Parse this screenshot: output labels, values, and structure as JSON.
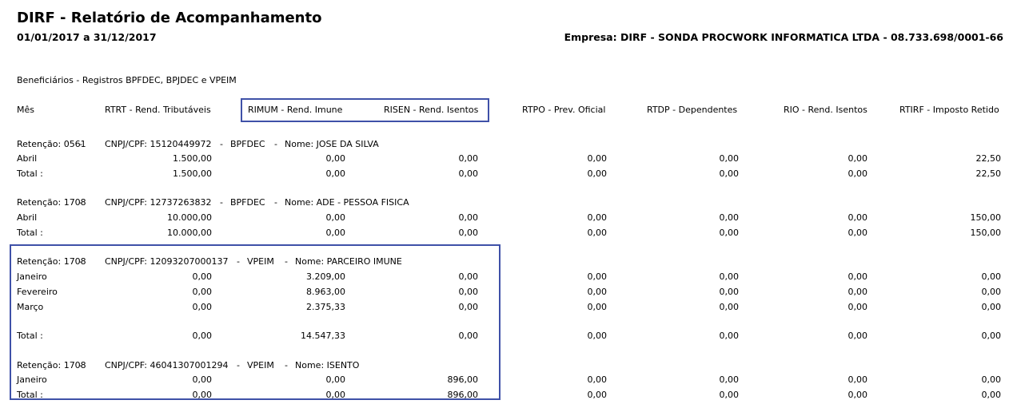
{
  "report": {
    "title": "DIRF - Relatório de Acompanhamento",
    "period": "01/01/2017 a 31/12/2017",
    "company": "Empresa: DIRF - SONDA PROCWORK INFORMATICA LTDA - 08.733.698/0001-66",
    "section": "Beneficiários - Registros BPFDEC, BPJDEC e VPEIM"
  },
  "columns": [
    "Mês",
    "RTRT - Rend. Tributáveis",
    "RIMUM - Rend. Imune",
    "RISEN - Rend. Isentos",
    "RTPO - Prev. Oficial",
    "RTDP - Dependentes",
    "RIO - Rend. Isentos",
    "RTIRF - Imposto Retido"
  ],
  "groups": [
    {
      "retencao": "Retenção: 0561",
      "cnpj": "CNPJ/CPF: 15120449972",
      "tipo": "BPFDEC",
      "nome": "Nome: JOSE DA SILVA",
      "rows": [
        {
          "label": "Abril",
          "values": [
            "1.500,00",
            "0,00",
            "0,00",
            "0,00",
            "0,00",
            "0,00",
            "22,50"
          ]
        },
        {
          "label": "Total :",
          "values": [
            "1.500,00",
            "0,00",
            "0,00",
            "0,00",
            "0,00",
            "0,00",
            "22,50"
          ]
        }
      ]
    },
    {
      "retencao": "Retenção: 1708",
      "cnpj": "CNPJ/CPF: 12737263832",
      "tipo": "BPFDEC",
      "nome": "Nome: ADE - PESSOA FISICA",
      "rows": [
        {
          "label": "Abril",
          "values": [
            "10.000,00",
            "0,00",
            "0,00",
            "0,00",
            "0,00",
            "0,00",
            "150,00"
          ]
        },
        {
          "label": "Total :",
          "values": [
            "10.000,00",
            "0,00",
            "0,00",
            "0,00",
            "0,00",
            "0,00",
            "150,00"
          ]
        }
      ]
    },
    {
      "retencao": "Retenção: 1708",
      "cnpj": "CNPJ/CPF: 12093207000137",
      "tipo": "VPEIM",
      "nome": "Nome: PARCEIRO IMUNE",
      "rows": [
        {
          "label": "Janeiro",
          "values": [
            "0,00",
            "3.209,00",
            "0,00",
            "0,00",
            "0,00",
            "0,00",
            "0,00"
          ]
        },
        {
          "label": "Fevereiro",
          "values": [
            "0,00",
            "8.963,00",
            "0,00",
            "0,00",
            "0,00",
            "0,00",
            "0,00"
          ]
        },
        {
          "label": "Março",
          "values": [
            "0,00",
            "2.375,33",
            "0,00",
            "0,00",
            "0,00",
            "0,00",
            "0,00"
          ]
        },
        {
          "label": "Total :",
          "values": [
            "0,00",
            "14.547,33",
            "0,00",
            "0,00",
            "0,00",
            "0,00",
            "0,00"
          ]
        }
      ]
    },
    {
      "retencao": "Retenção: 1708",
      "cnpj": "CNPJ/CPF: 46041307001294",
      "tipo": "VPEIM",
      "nome": "Nome: ISENTO",
      "rows": [
        {
          "label": "Janeiro",
          "values": [
            "0,00",
            "0,00",
            "896,00",
            "0,00",
            "0,00",
            "0,00",
            "0,00"
          ]
        },
        {
          "label": "Total :",
          "values": [
            "0,00",
            "0,00",
            "896,00",
            "0,00",
            "0,00",
            "0,00",
            "0,00"
          ]
        }
      ]
    }
  ]
}
